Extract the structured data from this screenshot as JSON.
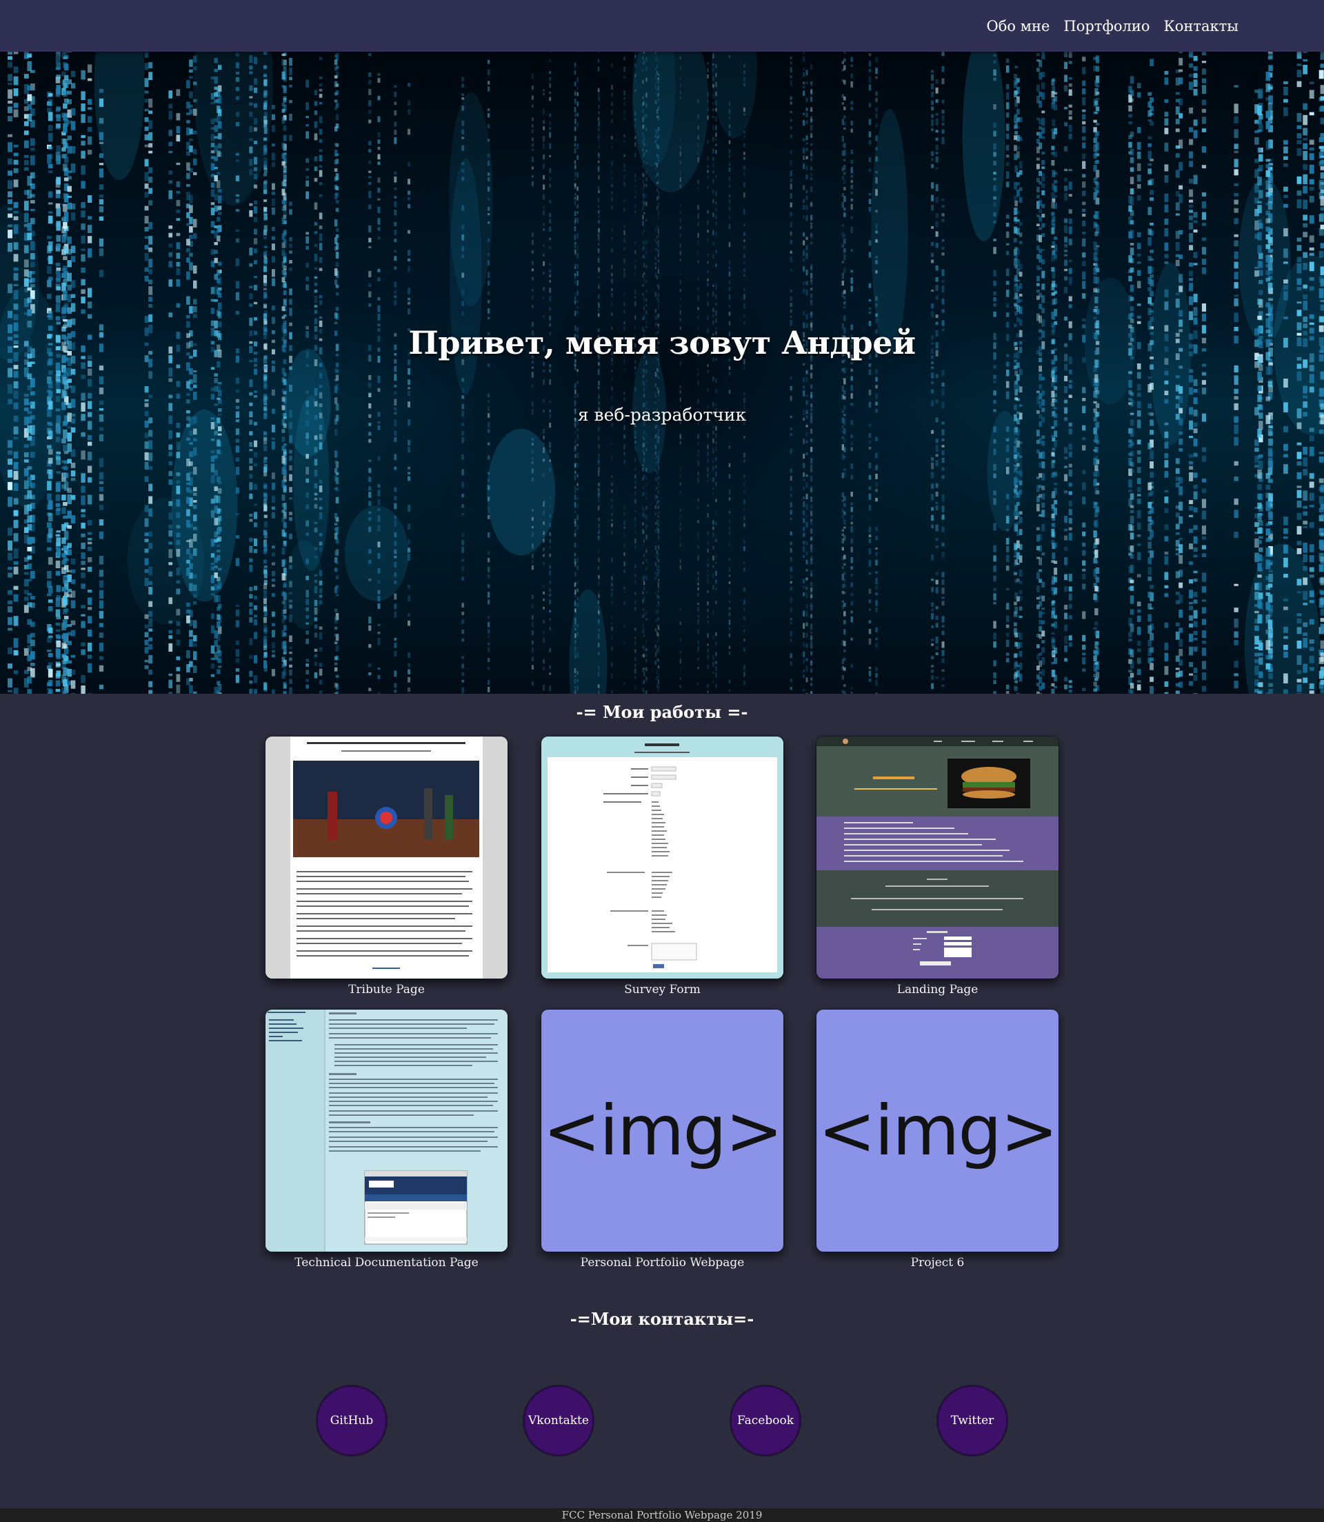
{
  "nav": {
    "items": [
      "Обо мне",
      "Портфолио",
      "Контакты"
    ]
  },
  "hero": {
    "title": "Привет, меня зовут Андрей",
    "subtitle": "я веб-разработчик"
  },
  "projects_section": {
    "title": "-= Мои работы =-",
    "items": [
      {
        "title": "Tribute Page",
        "thumb_header": "«Мстители» (англ. Avengers) — элитная команда супергероев"
      },
      {
        "title": "Survey Form",
        "thumb_header": "Форма опроса"
      },
      {
        "title": "Landing Page",
        "thumb_header": "VIP-ФудБургер"
      },
      {
        "title": "Technical Documentation Page",
        "thumb_header": "JavaScript Documentation"
      },
      {
        "title": "Personal Portfolio Webpage",
        "placeholder": "<img>"
      },
      {
        "title": "Project 6",
        "placeholder": "<img>"
      }
    ]
  },
  "contacts_section": {
    "title": "-=Мои контакты=-",
    "items": [
      "GitHub",
      "Vkontakte",
      "Facebook",
      "Twitter"
    ]
  },
  "footer": {
    "text": "FCC Personal Portfolio Webpage 2019"
  },
  "colors": {
    "nav_bg": "#2f3053",
    "page_bg": "#2b2c3d",
    "contact_bg": "#3f1069",
    "placeholder_bg": "#8a93e8"
  }
}
